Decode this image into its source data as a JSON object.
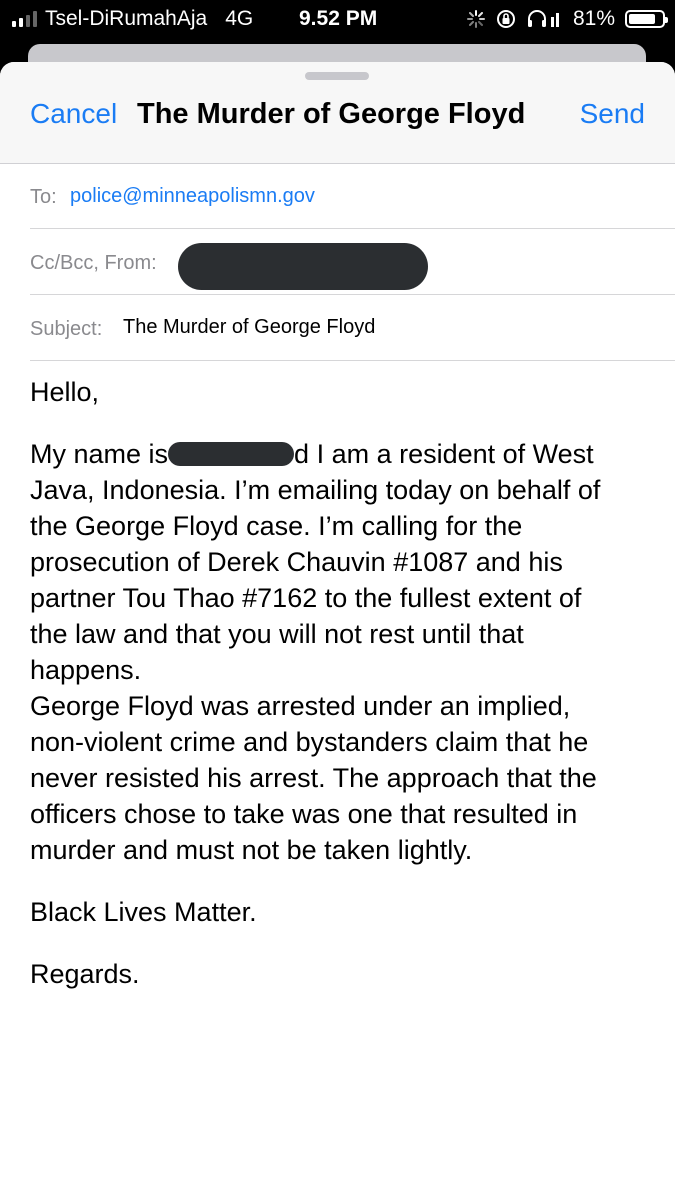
{
  "status_bar": {
    "carrier": "Tsel-DiRumahAja",
    "network": "4G",
    "time": "9.52 PM",
    "battery": "81%",
    "battery_level": 0.81,
    "signal_bars": 2
  },
  "compose": {
    "cancel_label": "Cancel",
    "title": "The Murder of George Floyd",
    "send_label": "Send",
    "to_label": "To:",
    "to_value": "police@minneapolismn.gov",
    "cc_label": "Cc/Bcc, From:",
    "subject_label": "Subject:",
    "subject_value": "The Murder of George Floyd"
  },
  "body": {
    "greeting": "Hello,",
    "p1_start": "My name is",
    "p1_after_redaction": "d I am a resident of West",
    "p1_lines": [
      "Java, Indonesia. I’m emailing today on behalf of",
      "the George Floyd case. I’m calling for the",
      "prosecution of Derek Chauvin #1087 and his",
      "partner Tou Thao #7162 to the fullest extent of",
      "the law and that you will not rest until that",
      "happens."
    ],
    "p2_lines": [
      "George Floyd was arrested under an implied,",
      "non-violent crime and bystanders claim that he",
      "never resisted his arrest. The approach that the",
      "officers chose to take was one that resulted in",
      "murder and must not be taken lightly."
    ],
    "p3": "Black Lives Matter.",
    "closing": "Regards."
  },
  "colors": {
    "accent": "#1a7cf4",
    "label_gray": "#8a8a8e",
    "redaction": "#2b2e31"
  }
}
